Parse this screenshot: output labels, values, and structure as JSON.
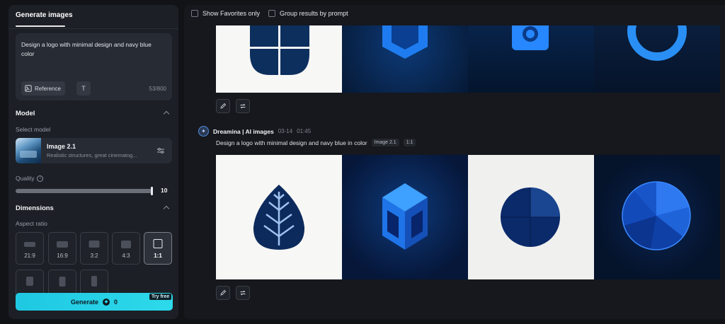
{
  "panel": {
    "tab_label": "Generate images",
    "prompt_text": "Design a logo with minimal design and navy blue color",
    "reference_label": "Reference",
    "text_tool_label": "T",
    "char_count": "53/800",
    "model_section": "Model",
    "select_model_label": "Select model",
    "model_name": "Image 2.1",
    "model_desc": "Realistic structures, great cinematog...",
    "quality_label": "Quality",
    "quality_value": "10",
    "quality_fraction": 1.0,
    "dimensions_section": "Dimensions",
    "aspect_ratio_label": "Aspect ratio",
    "ratios": [
      "21:9",
      "16:9",
      "3:2",
      "4:3",
      "1:1"
    ],
    "selected_ratio": "1:1",
    "generate_label": "Generate",
    "generate_cost": "0",
    "try_free": "Try free"
  },
  "main": {
    "show_favorites": "Show Favorites only",
    "group_by_prompt": "Group results by prompt",
    "group": {
      "name": "Dreamina | AI images",
      "date": "03-14",
      "time": "01:45",
      "prompt": "Design a logo with minimal design and navy blue in color",
      "model_chip": "Image 2.1",
      "ratio_chip": "1:1"
    }
  },
  "colors": {
    "accent": "#2dd9ea",
    "navy": "#0c2a5c",
    "bright_blue": "#1e7bef"
  }
}
